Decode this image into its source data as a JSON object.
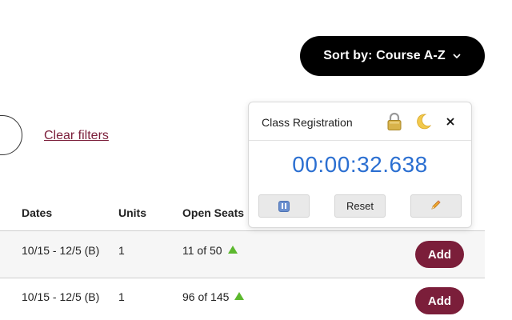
{
  "sort": {
    "label": "Sort by: Course A-Z",
    "icon": "chevron-down-icon"
  },
  "filters": {
    "clear_label": "Clear filters"
  },
  "table": {
    "columns": [
      "Dates",
      "Units",
      "Open Seats"
    ],
    "rows": [
      {
        "dates": "10/15 - 12/5 (B)",
        "units": "1",
        "open_seats": "11 of 50",
        "seats_icon": "triangle-up-icon",
        "action": "Add"
      },
      {
        "dates": "10/15 - 12/5 (B)",
        "units": "1",
        "open_seats": "96 of 145",
        "seats_icon": "triangle-up-icon",
        "action": "Add"
      }
    ]
  },
  "timer_popup": {
    "title": "Class Registration",
    "elapsed": "00:00:32.638",
    "icons": [
      "lock-icon",
      "moon-icon",
      "close-icon"
    ],
    "buttons": {
      "pause_icon": "pause-icon",
      "reset_label": "Reset",
      "edit_icon": "pencil-icon"
    }
  },
  "colors": {
    "brand_maroon": "#7b1e3a",
    "timer_blue": "#2b6fd1",
    "seat_green": "#5cb82e",
    "sort_bg": "#000000"
  }
}
